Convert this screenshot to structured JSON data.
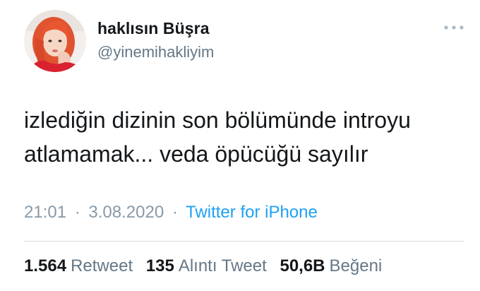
{
  "user": {
    "display_name": "haklısın Büşra",
    "handle": "@yinemihakliyim",
    "avatar_icon": "profile-photo"
  },
  "tweet": {
    "lines": [
      "izlediğin dizinin son bölümünde introyu",
      "atlamamak... veda öpücüğü sayılır"
    ]
  },
  "meta": {
    "time": "21:01",
    "date": "3.08.2020",
    "separator": "·",
    "source": "Twitter for iPhone"
  },
  "stats": {
    "retweets": {
      "count": "1.564",
      "label": "Retweet"
    },
    "quotes": {
      "count": "135",
      "label": "Alıntı Tweet"
    },
    "likes": {
      "count": "50,6B",
      "label": "Beğeni"
    }
  },
  "colors": {
    "text": "#14171a",
    "secondary": "#657786",
    "meta": "#8899a6",
    "link": "#1da1f2",
    "divider": "#d6dde3"
  }
}
